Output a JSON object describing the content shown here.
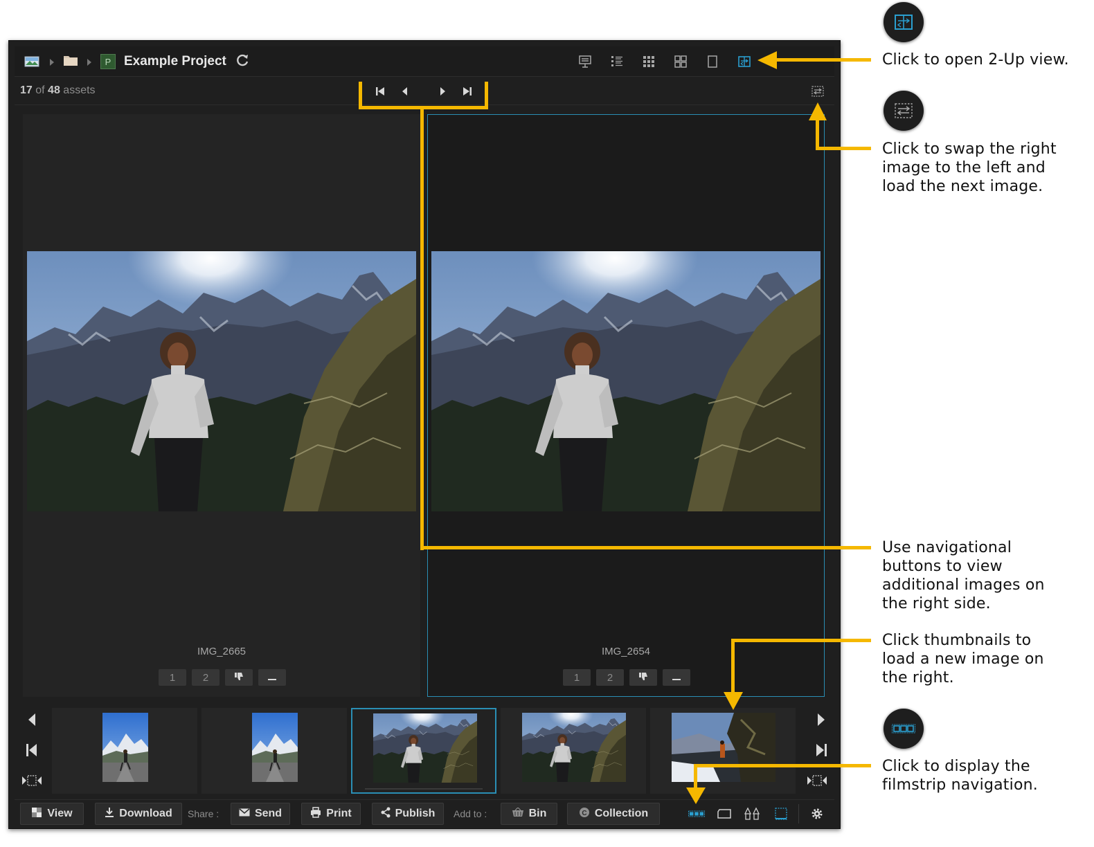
{
  "header": {
    "project_title": "Example Project"
  },
  "status": {
    "current": "17",
    "of_label": "of",
    "total": "48",
    "assets_label": "assets"
  },
  "panes": {
    "left": {
      "filename": "IMG_2665",
      "rating_buttons": [
        "1",
        "2"
      ]
    },
    "right": {
      "filename": "IMG_2654",
      "rating_buttons": [
        "1",
        "2"
      ]
    }
  },
  "toolbar": {
    "view_label": "View",
    "download_label": "Download",
    "share_label": "Share :",
    "send_label": "Send",
    "print_label": "Print",
    "publish_label": "Publish",
    "add_to_label": "Add to :",
    "bin_label": "Bin",
    "collection_label": "Collection"
  },
  "annotations": {
    "two_up": "Click to open 2-Up view.",
    "swap": [
      "Click to swap the right",
      "image to the left and",
      "load the next image."
    ],
    "nav": [
      "Use navigational",
      "buttons to view",
      "additional images on",
      "the right side."
    ],
    "thumbs": [
      "Click thumbnails to",
      "load a new image on",
      "the right."
    ],
    "filmstrip": [
      "Click to display the",
      "filmstrip navigation."
    ]
  },
  "colors": {
    "accent": "#2a8fb5",
    "callout_yellow": "#f5b800",
    "app_background": "#1f1f1f"
  },
  "icons": [
    "image-icon",
    "folder-icon",
    "project-icon",
    "refresh-icon",
    "presentation-view-icon",
    "list-view-icon",
    "small-grid-icon",
    "large-grid-icon",
    "single-view-icon",
    "two-up-view-icon",
    "first-icon",
    "previous-icon",
    "next-icon",
    "last-icon",
    "swap-icon",
    "thumbs-down-icon",
    "minus-icon",
    "download-icon",
    "mail-icon",
    "printer-icon",
    "share-icon",
    "basket-icon",
    "collection-icon",
    "filmstrip-icon",
    "rectangle-icon",
    "compare-icon",
    "frame-icon",
    "gear-icon"
  ]
}
